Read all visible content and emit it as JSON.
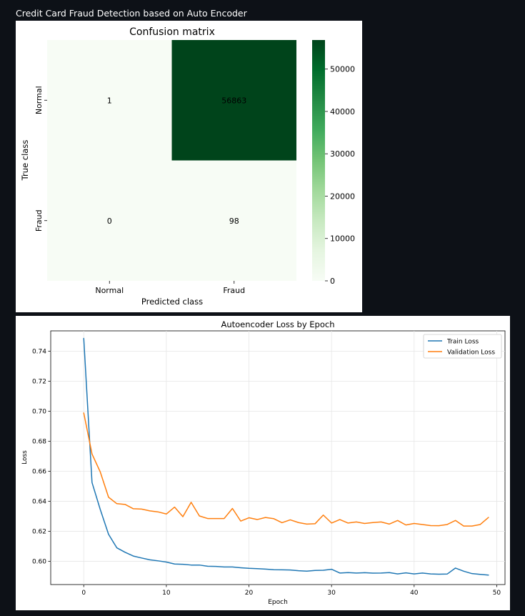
{
  "page": {
    "title": "Credit Card Fraud Detection based on Auto Encoder"
  },
  "colors": {
    "page_background": "#0d1117",
    "cm_low": "#f7fcf5",
    "cm_high": "#00441b",
    "train_line": "#1f77b4",
    "validation_line": "#ff7f0e"
  },
  "chart_data": [
    {
      "type": "heatmap",
      "title": "Confusion matrix",
      "xlabel": "Predicted class",
      "ylabel": "True class",
      "x_categories": [
        "Normal",
        "Fraud"
      ],
      "y_categories": [
        "Normal",
        "Fraud"
      ],
      "values": [
        [
          1,
          56863
        ],
        [
          0,
          98
        ]
      ],
      "colormap": "Greens",
      "colorbar": {
        "range": [
          0,
          56863
        ],
        "ticks": [
          0,
          10000,
          20000,
          30000,
          40000,
          50000
        ]
      }
    },
    {
      "type": "line",
      "title": "Autoencoder Loss by Epoch",
      "xlabel": "Epoch",
      "ylabel": "Loss",
      "xlim": [
        -4,
        51
      ],
      "ylim": [
        0.5845,
        0.7535
      ],
      "xticks": [
        0,
        10,
        20,
        30,
        40,
        50
      ],
      "yticks": [
        0.6,
        0.62,
        0.64,
        0.66,
        0.68,
        0.7,
        0.72,
        0.74
      ],
      "ytick_labels": [
        "0.60",
        "0.62",
        "0.64",
        "0.66",
        "0.68",
        "0.70",
        "0.72",
        "0.74"
      ],
      "grid": true,
      "legend_position": "top-right",
      "x": [
        0,
        1,
        2,
        3,
        4,
        5,
        6,
        7,
        8,
        9,
        10,
        11,
        12,
        13,
        14,
        15,
        16,
        17,
        18,
        19,
        20,
        21,
        22,
        23,
        24,
        25,
        26,
        27,
        28,
        29,
        30,
        31,
        32,
        33,
        34,
        35,
        36,
        37,
        38,
        39,
        40,
        41,
        42,
        43,
        44,
        45,
        46,
        47,
        48,
        49
      ],
      "series": [
        {
          "name": "Train Loss",
          "color": "#1f77b4",
          "values": [
            0.7485,
            0.6525,
            0.6345,
            0.618,
            0.609,
            0.606,
            0.6035,
            0.6022,
            0.601,
            0.6003,
            0.5995,
            0.5982,
            0.598,
            0.5975,
            0.5975,
            0.5967,
            0.5966,
            0.5962,
            0.5962,
            0.5957,
            0.5953,
            0.5951,
            0.5948,
            0.5944,
            0.5943,
            0.5942,
            0.5937,
            0.5934,
            0.5939,
            0.594,
            0.5947,
            0.5922,
            0.5925,
            0.5922,
            0.5924,
            0.5921,
            0.5922,
            0.5925,
            0.5916,
            0.5923,
            0.5916,
            0.5922,
            0.5916,
            0.5914,
            0.5915,
            0.5955,
            0.5934,
            0.5918,
            0.5913,
            0.5908
          ]
        },
        {
          "name": "Validation Loss",
          "color": "#ff7f0e",
          "values": [
            0.6988,
            0.6715,
            0.6595,
            0.6427,
            0.6384,
            0.6379,
            0.635,
            0.6348,
            0.6336,
            0.6329,
            0.6315,
            0.6361,
            0.6297,
            0.6393,
            0.6302,
            0.6285,
            0.6285,
            0.6285,
            0.6352,
            0.6268,
            0.629,
            0.6278,
            0.6292,
            0.6284,
            0.6257,
            0.6276,
            0.6258,
            0.6248,
            0.625,
            0.6308,
            0.6255,
            0.6278,
            0.6255,
            0.6262,
            0.6252,
            0.6258,
            0.6262,
            0.6248,
            0.6272,
            0.6242,
            0.6252,
            0.6245,
            0.6238,
            0.6237,
            0.6245,
            0.6272,
            0.6235,
            0.6235,
            0.6245,
            0.6292
          ]
        }
      ]
    }
  ]
}
